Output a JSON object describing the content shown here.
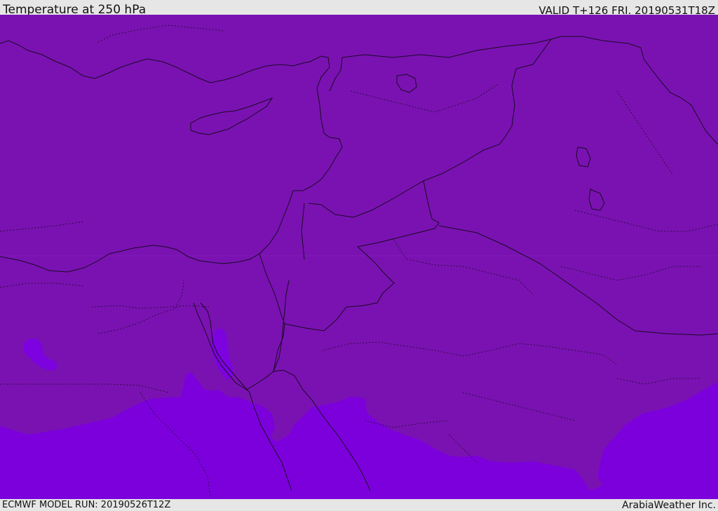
{
  "header": {
    "title": "Temperature at 250 hPa",
    "valid": "VALID T+126 FRI. 20190531T18Z"
  },
  "footer": {
    "model_run": "ECMWF MODEL RUN: 20190526T12Z",
    "credit": "ArabiaWeather Inc."
  },
  "map": {
    "colors": {
      "cold_band": "#7a12b2",
      "warm_band": "#7c00dc",
      "warm_patch": "#7d02e0",
      "border": "#1a0a22",
      "frame_bg": "#e6e6e6"
    }
  }
}
